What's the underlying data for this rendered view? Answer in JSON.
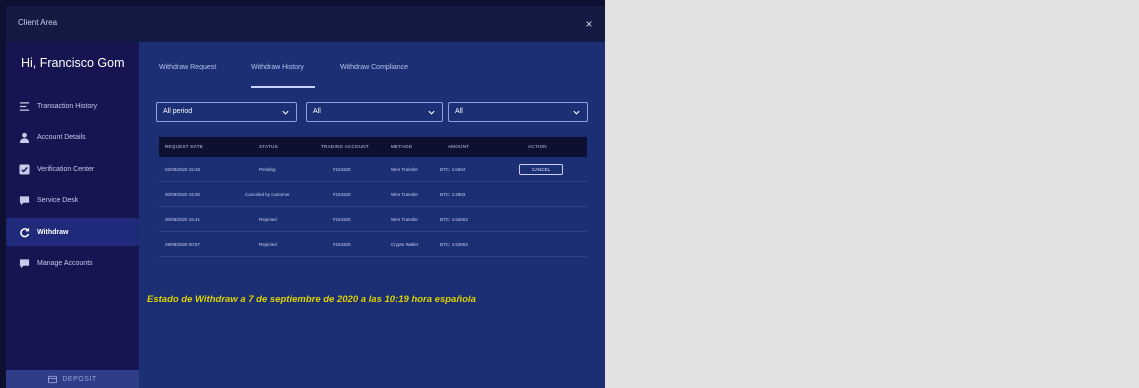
{
  "window": {
    "title": "Client Area",
    "close_icon": "×"
  },
  "sidebar": {
    "greeting": "Hi, Francisco  Gom",
    "items": [
      {
        "label": "Transaction History",
        "icon": "list-icon"
      },
      {
        "label": "Account Details",
        "icon": "user-icon"
      },
      {
        "label": "Verification Center",
        "icon": "check-icon"
      },
      {
        "label": "Service Desk",
        "icon": "chat-icon"
      },
      {
        "label": "Withdraw",
        "icon": "refresh-icon",
        "active": true
      },
      {
        "label": "Manage Accounts",
        "icon": "chat-icon"
      }
    ],
    "deposit_label": "DEPOSIT"
  },
  "tabs": [
    {
      "label": "Withdraw Request"
    },
    {
      "label": "Withdraw History",
      "active": true
    },
    {
      "label": "Withdraw Compliance"
    }
  ],
  "filters": [
    {
      "value": "All period"
    },
    {
      "value": "All"
    },
    {
      "value": "All"
    }
  ],
  "table": {
    "headers": [
      "REQUEST DATE",
      "STATUS",
      "TRADING ACCOUNT",
      "METHOD",
      "AMOUNT",
      "ACTION"
    ],
    "rows": [
      {
        "date": "02/09/2020 15:48",
        "status": "Pending",
        "account": "#104320",
        "method": "Wire Transfer",
        "amount": "BTC: 4.5604",
        "action": "CANCEL"
      },
      {
        "date": "00/09/2020 19:30",
        "status": "Canceled by customer",
        "account": "#104320",
        "method": "Wire Transfer",
        "amount": "BTC: 4.2803",
        "action": ""
      },
      {
        "date": "30/08/2020 16:41",
        "status": "Rejected",
        "account": "#104320",
        "method": "Wire Transfer",
        "amount": "BTC: 4.52653",
        "action": ""
      },
      {
        "date": "29/08/2020 00:57",
        "status": "Rejected",
        "account": "#104320",
        "method": "Crypto Wallet",
        "amount": "BTC: 4.52653",
        "action": ""
      }
    ]
  },
  "overlay_text": "Estado de Withdraw  a 7 de septiembre de 2020 a las 10:19 hora española",
  "colors": {
    "sidebar": "#161552",
    "main": "#1c2f74",
    "header": "#0d1030",
    "overlay": "#ddd200"
  }
}
